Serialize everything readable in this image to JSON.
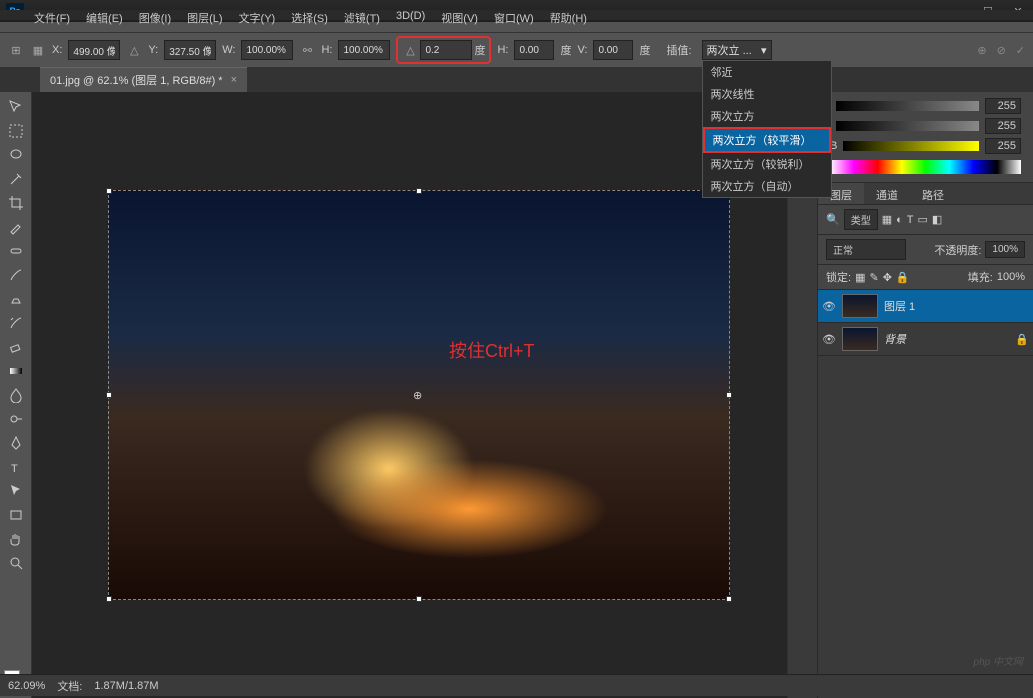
{
  "app": {
    "logo": "Ps"
  },
  "menu": {
    "file": "文件(F)",
    "edit": "编辑(E)",
    "image": "图像(I)",
    "layer": "图层(L)",
    "type": "文字(Y)",
    "select": "选择(S)",
    "filter": "滤镜(T)",
    "threed": "3D(D)",
    "view": "视图(V)",
    "window": "窗口(W)",
    "help": "帮助(H)"
  },
  "options": {
    "x_label": "X:",
    "x_value": "499.00 像",
    "y_label": "Y:",
    "y_value": "327.50 像",
    "w_label": "W:",
    "w_value": "100.00%",
    "h_label": "H:",
    "h_value": "100.00%",
    "angle_value": "0.2",
    "angle_unit": "度",
    "h2_label": "H:",
    "h2_value": "0.00",
    "h2_unit": "度",
    "v_label": "V:",
    "v_value": "0.00",
    "v_unit": "度",
    "interp_label": "插值:",
    "interp_value": "两次立 ..."
  },
  "interp_menu": {
    "opt1": "邻近",
    "opt2": "两次线性",
    "opt3": "两次立方",
    "opt4": "两次立方（较平滑）",
    "opt5": "两次立方（较锐利）",
    "opt6": "两次立方（自动）"
  },
  "tab": {
    "title": "01.jpg @ 62.1% (图层 1, RGB/8#) *"
  },
  "canvas": {
    "hint": "按住Ctrl+T"
  },
  "color_panel": {
    "b_label": "B",
    "val1": "255",
    "val2": "255",
    "val3": "255"
  },
  "layers": {
    "tab1": "图层",
    "tab2": "通道",
    "tab3": "路径",
    "kind_label": "类型",
    "blend_mode": "正常",
    "opacity_label": "不透明度:",
    "opacity_value": "100%",
    "lock_label": "锁定:",
    "fill_label": "填充:",
    "fill_value": "100%",
    "layer1": "图层 1",
    "layer_bg": "背景"
  },
  "status": {
    "zoom": "62.09%",
    "doc_label": "文档:",
    "doc_value": "1.87M/1.87M"
  },
  "watermark": "php 中文网"
}
